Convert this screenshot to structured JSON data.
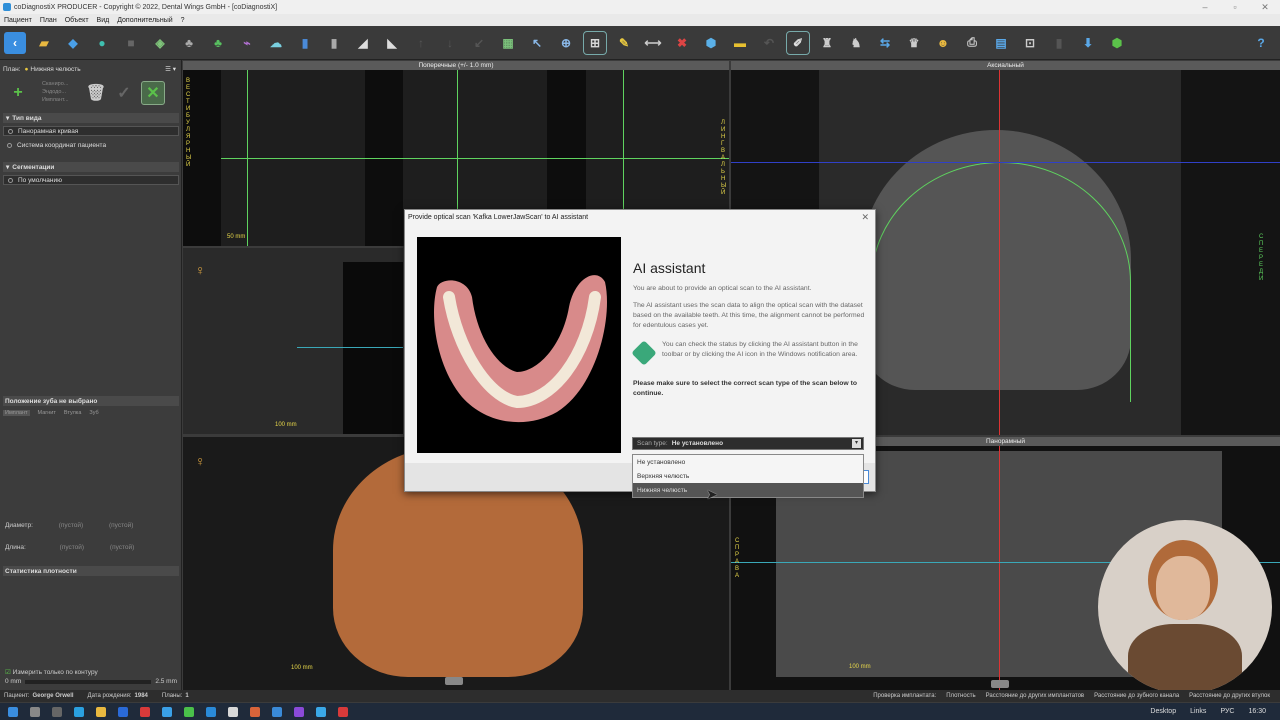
{
  "window": {
    "title": "coDiagnostiX PRODUCER - Copyright © 2022, Dental Wings GmbH - [coDiagnostiX]"
  },
  "menu": [
    "Пациент",
    "План",
    "Объект",
    "Вид",
    "Дополнительный",
    "?"
  ],
  "left_panel": {
    "plan_label": "План:",
    "plan_value": "Нижняя челюсть",
    "side_labels": [
      "Сканиро...",
      "Эндодо...",
      "Имплант..."
    ],
    "view_type_header": "Тип вида",
    "view_types": [
      "Панорамная кривая",
      "Система координат пациента"
    ],
    "segment_header": "Сегментации",
    "segments": [
      "По умолчанию"
    ],
    "tooth_position": "Положение зуба не выбрано",
    "tabs": [
      "Имплант",
      "Магнит",
      "Втулка",
      "Зуб"
    ],
    "diameter_label": "Диаметр:",
    "length_label": "Длина:",
    "empty_value": "(пустой)",
    "density_stats": "Статистика плотности",
    "measure_contour": "Измерить только по контуру",
    "range_min": "0 mm",
    "range_max": "2.5 mm"
  },
  "viewports": {
    "cross_title": "Поперечные (+/- 1.0 mm)",
    "axial_title": "Аксиальный",
    "pano_title": "Панорамный",
    "scale_50": "50 mm",
    "scale_100": "100 mm",
    "vertical_left": "ВЕСТИБУЛЯРНЫЙ",
    "vertical_right": "ЛИНГВАЛЬНЫЙ",
    "right_side": "СПЕРЕДИ",
    "pano_side": "СПРАВА"
  },
  "dialog": {
    "title": "Provide optical scan 'Kafka LowerJawScan' to AI assistant",
    "heading": "AI assistant",
    "p1": "You are about to provide an optical scan to the AI assistant.",
    "p2": "The AI assistant uses the scan data to align the optical scan with the dataset based on the available teeth. At this time, the alignment cannot be performed for edentulous cases yet.",
    "p3": "You can check the status by clicking the AI assistant button in the toolbar or by clicking the AI icon in the Windows notification area.",
    "bold": "Please make sure to select the correct scan type of the scan below to continue.",
    "scan_type_label": "Scan type:",
    "scan_type_value": "Не установлено",
    "options": [
      "Не установлено",
      "Верхняя челюсть",
      "Нижняя челюсть"
    ],
    "selected_option_index": 2
  },
  "status": {
    "patient_label": "Пациент:",
    "patient_name": "George Orwell",
    "dob_label": "Дата рождения:",
    "dob": "1984",
    "plans_label": "Планы:",
    "plans": "1",
    "right_items": [
      "Проверка имплантата:",
      "Плотность",
      "Расстояние до других имплантатов",
      "Расстояние до зубного канала",
      "Расстояние до других втулок"
    ]
  },
  "taskbar": {
    "desktop": "Desktop",
    "links": "Links",
    "lang": "РУС",
    "time": "16:30"
  },
  "colors": {
    "accent_green": "#5bc24a",
    "crosshair_green": "#5fd35f",
    "crosshair_red": "#d33",
    "crosshair_blue": "#3040c8",
    "scale_yellow": "#e8d84a"
  }
}
